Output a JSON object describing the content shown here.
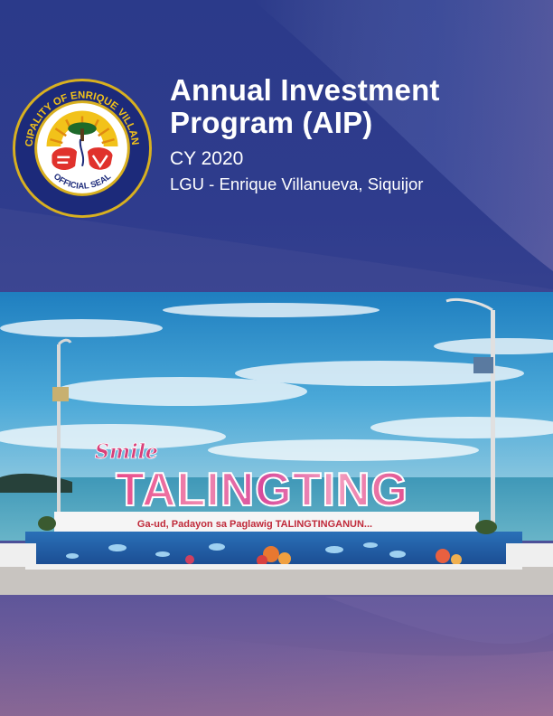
{
  "header": {
    "title": "Annual Investment Program (AIP)",
    "year": "CY 2020",
    "lgu": "LGU - Enrique Villanueva, Siquijor"
  },
  "seal": {
    "ring_text": "MUNICIPALITY OF ENRIQUE VILLANUEVA",
    "bottom_text": "OFFICIAL SEAL",
    "monogram": "EV",
    "colors": {
      "ring": "#1c2a7a",
      "inner": "#f2c21a",
      "border": "#d8b020",
      "accent": "#e0322c"
    }
  },
  "photo": {
    "sign_script": "Smile",
    "sign_main": "TALINGTING",
    "sign_slogan": "Ga-ud, Padayon sa Paglawig TALINGTINGANUN..."
  },
  "colors": {
    "background_top": "#2b3a8a",
    "background_bottom": "#8a6690",
    "sky": "#3a9fd0",
    "sea": "#4aa3bf"
  }
}
